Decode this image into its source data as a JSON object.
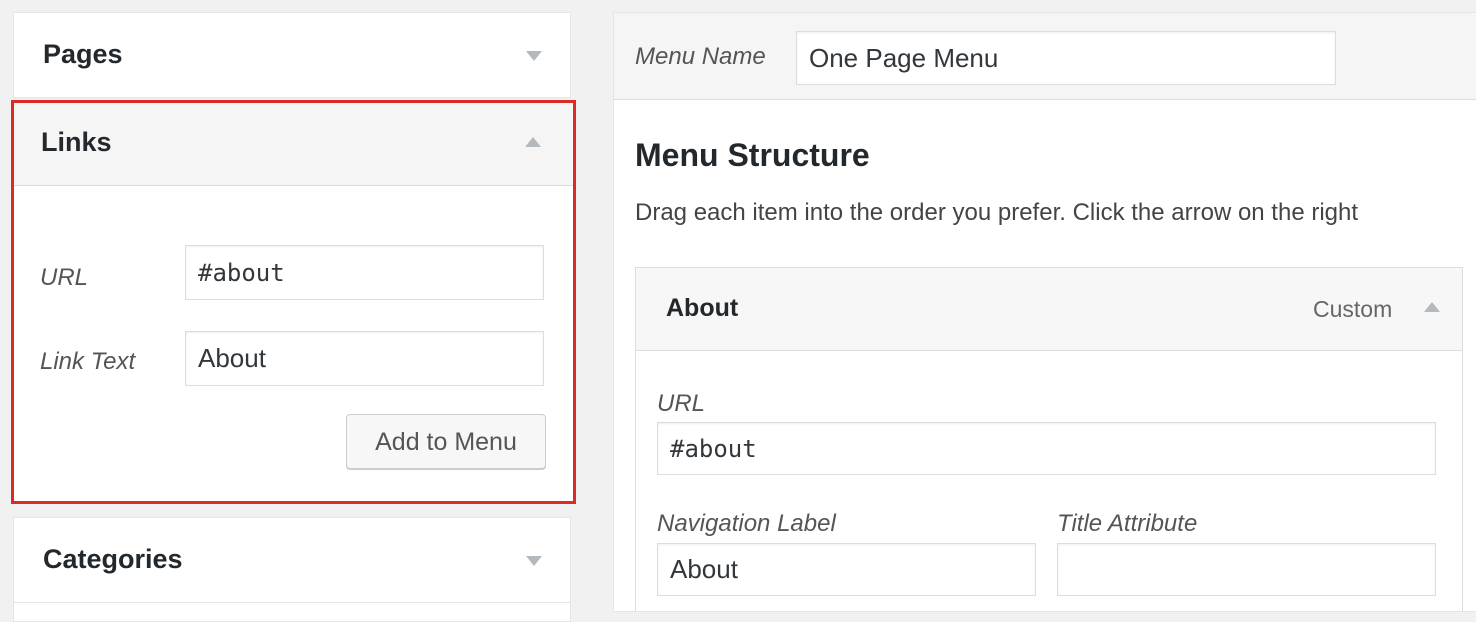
{
  "left_panel": {
    "pages_title": "Pages",
    "links": {
      "title": "Links",
      "url_label": "URL",
      "url_value": "#about",
      "link_text_label": "Link Text",
      "link_text_value": "About",
      "add_button": "Add to Menu"
    },
    "categories_title": "Categories"
  },
  "right_panel": {
    "menu_name_label": "Menu Name",
    "menu_name_value": "One Page Menu",
    "structure_title": "Menu Structure",
    "structure_desc": "Drag each item into the order you prefer. Click the arrow on the right",
    "menu_item": {
      "title": "About",
      "type": "Custom",
      "url_label": "URL",
      "url_value": "#about",
      "nav_label_label": "Navigation Label",
      "nav_label_value": "About",
      "title_attr_label": "Title Attribute",
      "title_attr_value": ""
    }
  },
  "colors": {
    "highlight_border": "#dc2a25",
    "panel_header_bg": "#f5f5f5",
    "arrow_gray": "#b4b9be"
  }
}
